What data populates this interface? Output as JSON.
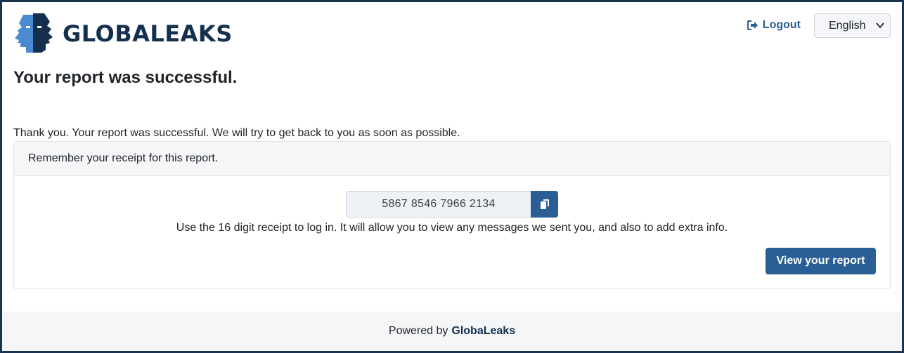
{
  "header": {
    "logo_text": "GLOBALEAKS",
    "logout_label": "Logout",
    "language_selected": "English"
  },
  "main": {
    "title": "Your report was successful.",
    "thanks_text": "Thank you. Your report was successful. We will try to get back to you as soon as possible.",
    "card": {
      "header": "Remember your receipt for this report.",
      "receipt_value": "5867 8546 7966 2134",
      "help_text": "Use the 16 digit receipt to log in. It will allow you to view any messages we sent you, and also to add extra info.",
      "view_button_label": "View your report"
    }
  },
  "footer": {
    "powered_by": "Powered by",
    "brand": "GlobaLeaks"
  },
  "colors": {
    "primary": "#2a5f95",
    "logo_dark": "#15304f",
    "logo_light": "#4a8ad0",
    "frame": "#1a3350"
  },
  "icons": {
    "logo": "globaleaks-faces-logo",
    "logout": "sign-out-icon",
    "select": "chevron-down-icon",
    "copy": "copy-icon"
  }
}
